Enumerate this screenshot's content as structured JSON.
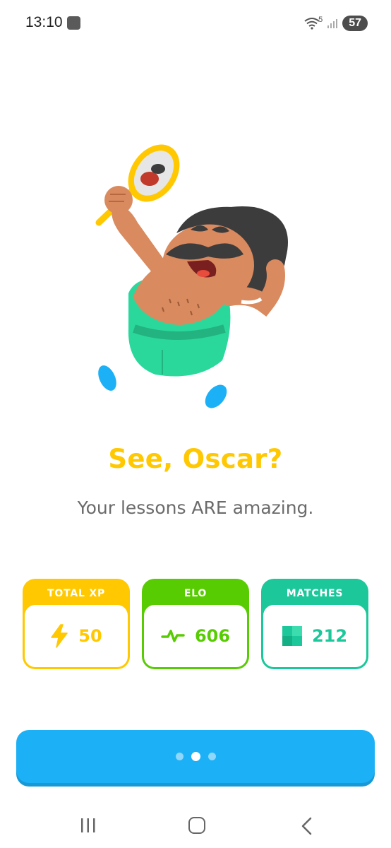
{
  "status_bar": {
    "time": "13:10",
    "battery": "57",
    "wifi_badge": "5"
  },
  "illustration": {
    "icon": "character-with-mirror-illustration"
  },
  "headline": "See, Oscar?",
  "subtext": "Your lessons ARE amazing.",
  "stats": [
    {
      "label": "TOTAL XP",
      "value": "50",
      "icon": "lightning-bolt-icon",
      "color": "#ffc800"
    },
    {
      "label": "ELO",
      "value": "606",
      "icon": "activity-pulse-icon",
      "color": "#58cc02"
    },
    {
      "label": "MATCHES",
      "value": "212",
      "icon": "grid-square-icon",
      "color": "#1cc79a"
    }
  ],
  "continue_button": {
    "state": "loading",
    "color": "#1cb0f6"
  },
  "nav_bar": {
    "recents_icon": "recents-icon",
    "home_icon": "home-icon",
    "back_icon": "back-icon"
  }
}
